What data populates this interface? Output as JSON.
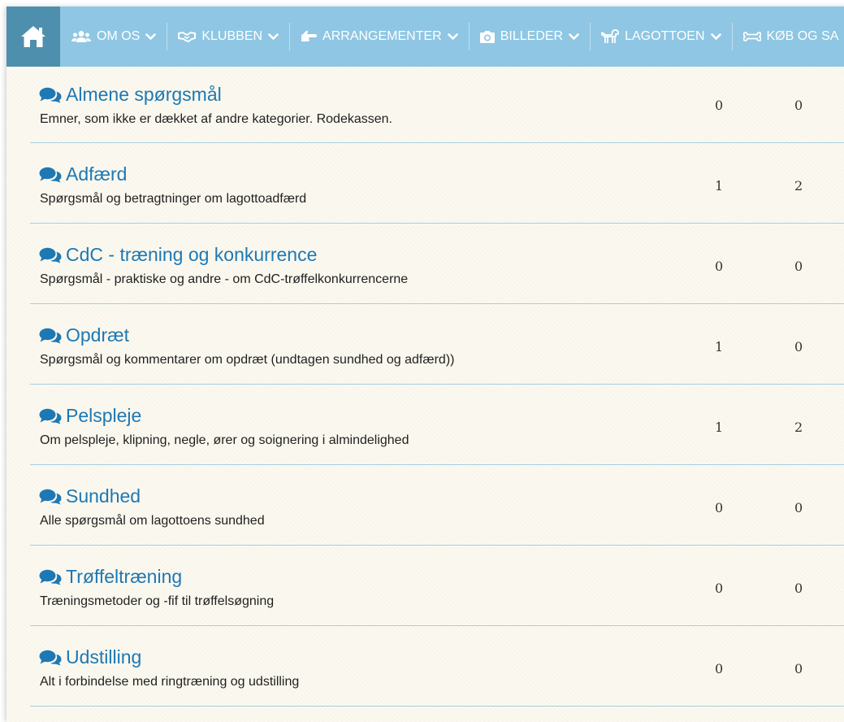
{
  "colors": {
    "navbar": "#8fc6e3",
    "home": "#4e8fae",
    "link": "#1e78b4",
    "divider": "#a9cde2",
    "panel": "#fbf9ef"
  },
  "nav": {
    "home_icon": "home-icon",
    "items": [
      {
        "label": "OM OS",
        "icon": "users-icon"
      },
      {
        "label": "KLUBBEN",
        "icon": "handshake-icon"
      },
      {
        "label": "ARRANGEMENTER",
        "icon": "hand-point-icon"
      },
      {
        "label": "BILLEDER",
        "icon": "camera-icon"
      },
      {
        "label": "LAGOTTOEN",
        "icon": "dog-icon"
      },
      {
        "label": "KØB OG SA",
        "icon": "bone-icon"
      }
    ]
  },
  "forums": [
    {
      "title": "Almene spørgsmål",
      "description": "Emner, som ikke er dækket af andre kategorier. Rodekassen.",
      "topics": "0",
      "posts": "0"
    },
    {
      "title": "Adfærd",
      "description": "Spørgsmål og betragtninger om lagottoadfærd",
      "topics": "1",
      "posts": "2"
    },
    {
      "title": "CdC - træning og konkurrence",
      "description": "Spørgsmål - praktiske og andre - om CdC-trøffelkonkurrencerne",
      "topics": "0",
      "posts": "0"
    },
    {
      "title": "Opdræt",
      "description": "Spørgsmål og kommentarer om opdræt (undtagen sundhed og adfærd))",
      "topics": "1",
      "posts": "0"
    },
    {
      "title": "Pelspleje",
      "description": "Om pelspleje, klipning, negle, ører og soignering i almindelighed",
      "topics": "1",
      "posts": "2"
    },
    {
      "title": "Sundhed",
      "description": "Alle spørgsmål om lagottoens sundhed",
      "topics": "0",
      "posts": "0"
    },
    {
      "title": "Trøffeltræning",
      "description": "Træningsmetoder og -fif til trøffelsøgning",
      "topics": "0",
      "posts": "0"
    },
    {
      "title": "Udstilling",
      "description": "Alt i forbindelse med ringtræning og udstilling",
      "topics": "0",
      "posts": "0"
    }
  ]
}
